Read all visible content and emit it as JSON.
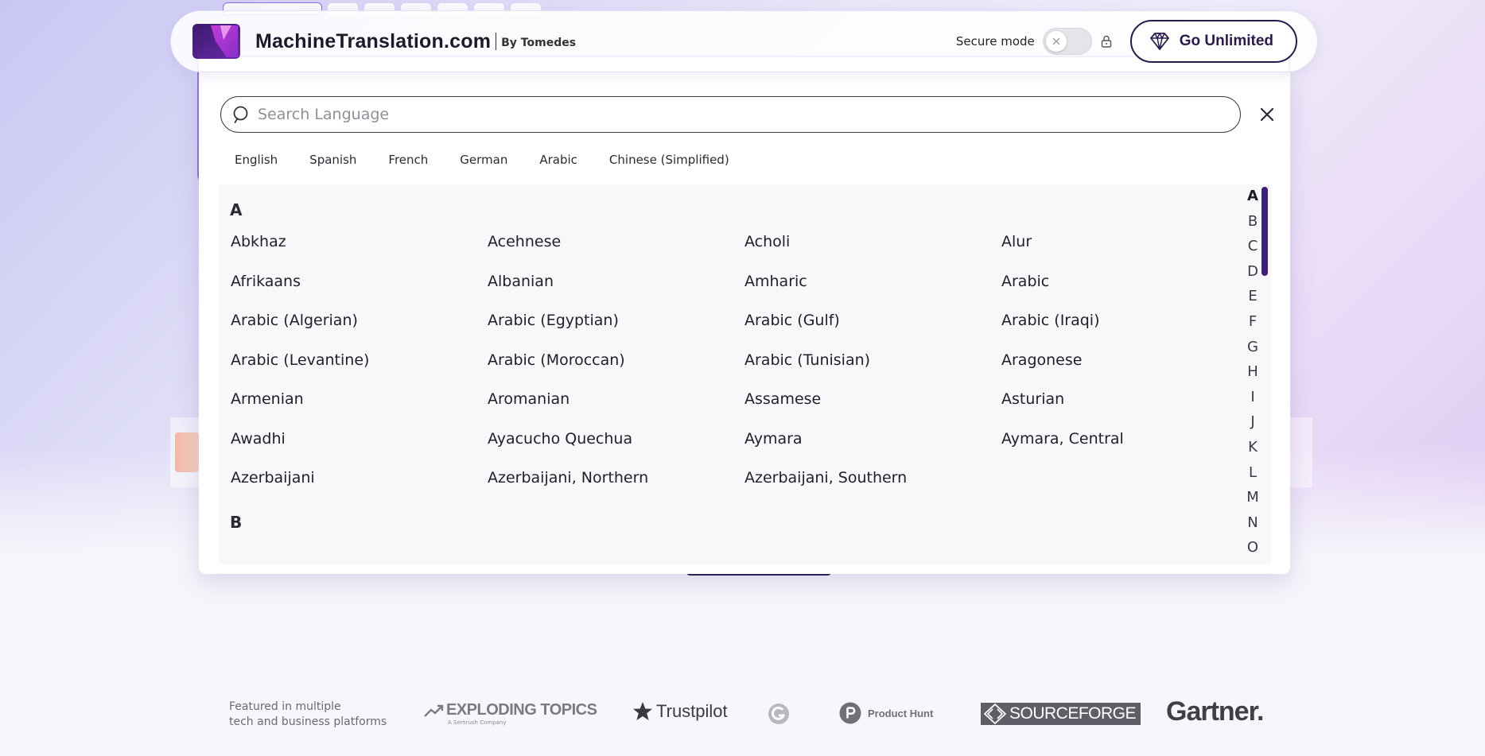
{
  "header": {
    "brand": "MachineTranslation.com",
    "by": "By Tomedes",
    "secure_mode_label": "Secure mode",
    "secure_mode_on": false,
    "go_unlimited_label": "Go Unlimited",
    "toggle_icon": "close-icon",
    "lock_icon": "lock-icon",
    "upgrade_icon": "gem-icon",
    "brand_colors": {
      "dark": "#2a1a4e",
      "accent": "#9b3fd6"
    }
  },
  "language_picker": {
    "search_placeholder": "Search Language",
    "search_value": "",
    "close_icon": "close-icon",
    "quick_languages": [
      "English",
      "Spanish",
      "French",
      "German",
      "Arabic",
      "Chinese (Simplified)"
    ],
    "sections": [
      {
        "letter": "A",
        "languages": [
          "Abkhaz",
          "Acehnese",
          "Acholi",
          "Alur",
          "Afrikaans",
          "Albanian",
          "Amharic",
          "Arabic",
          "Arabic (Algerian)",
          "Arabic (Egyptian)",
          "Arabic (Gulf)",
          "Arabic (Iraqi)",
          "Arabic (Levantine)",
          "Arabic (Moroccan)",
          "Arabic (Tunisian)",
          "Aragonese",
          "Armenian",
          "Aromanian",
          "Assamese",
          "Asturian",
          "Awadhi",
          "Ayacucho Quechua",
          "Aymara",
          "Aymara, Central",
          "Azerbaijani",
          "Azerbaijani, Northern",
          "Azerbaijani, Southern"
        ]
      },
      {
        "letter": "B",
        "languages": []
      }
    ],
    "alphabet_index": [
      "A",
      "B",
      "C",
      "D",
      "E",
      "F",
      "G",
      "H",
      "I",
      "J",
      "K",
      "L",
      "M",
      "N",
      "O"
    ],
    "active_letter": "A"
  },
  "featured": {
    "line1": "Featured in multiple",
    "line2": "tech and business platforms",
    "exploding_topics": "EXPLODING TOPICS",
    "exploding_topics_sub": "A Semrush Company",
    "trustpilot": "Trustpilot",
    "product_hunt": "Product Hunt",
    "sourceforge": "SOURCEFORGE",
    "gartner": "Gartner."
  }
}
